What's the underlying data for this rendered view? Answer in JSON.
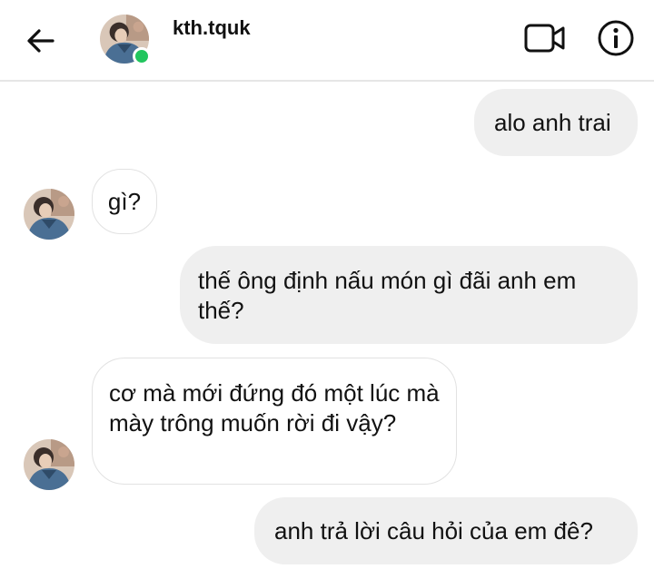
{
  "header": {
    "username": "kth.tquk",
    "online_color": "#22c55e",
    "icons": [
      "arrow-left-icon",
      "video-camera-icon",
      "info-icon"
    ]
  },
  "messages": [
    {
      "direction": "outgoing",
      "text": "alo anh trai"
    },
    {
      "direction": "incoming",
      "text": "gì?"
    },
    {
      "direction": "outgoing",
      "text": "thế ông định nấu món gì đãi anh em thế?"
    },
    {
      "direction": "incoming",
      "text": "cơ mà mới đứng đó một lúc mà mày trông muốn rời đi vậy?"
    },
    {
      "direction": "outgoing",
      "text": "anh trả lời câu hỏi của em đê?"
    }
  ],
  "colors": {
    "outgoing_bubble": "#efefef",
    "incoming_border": "#e2e2e2",
    "text": "#111111"
  }
}
